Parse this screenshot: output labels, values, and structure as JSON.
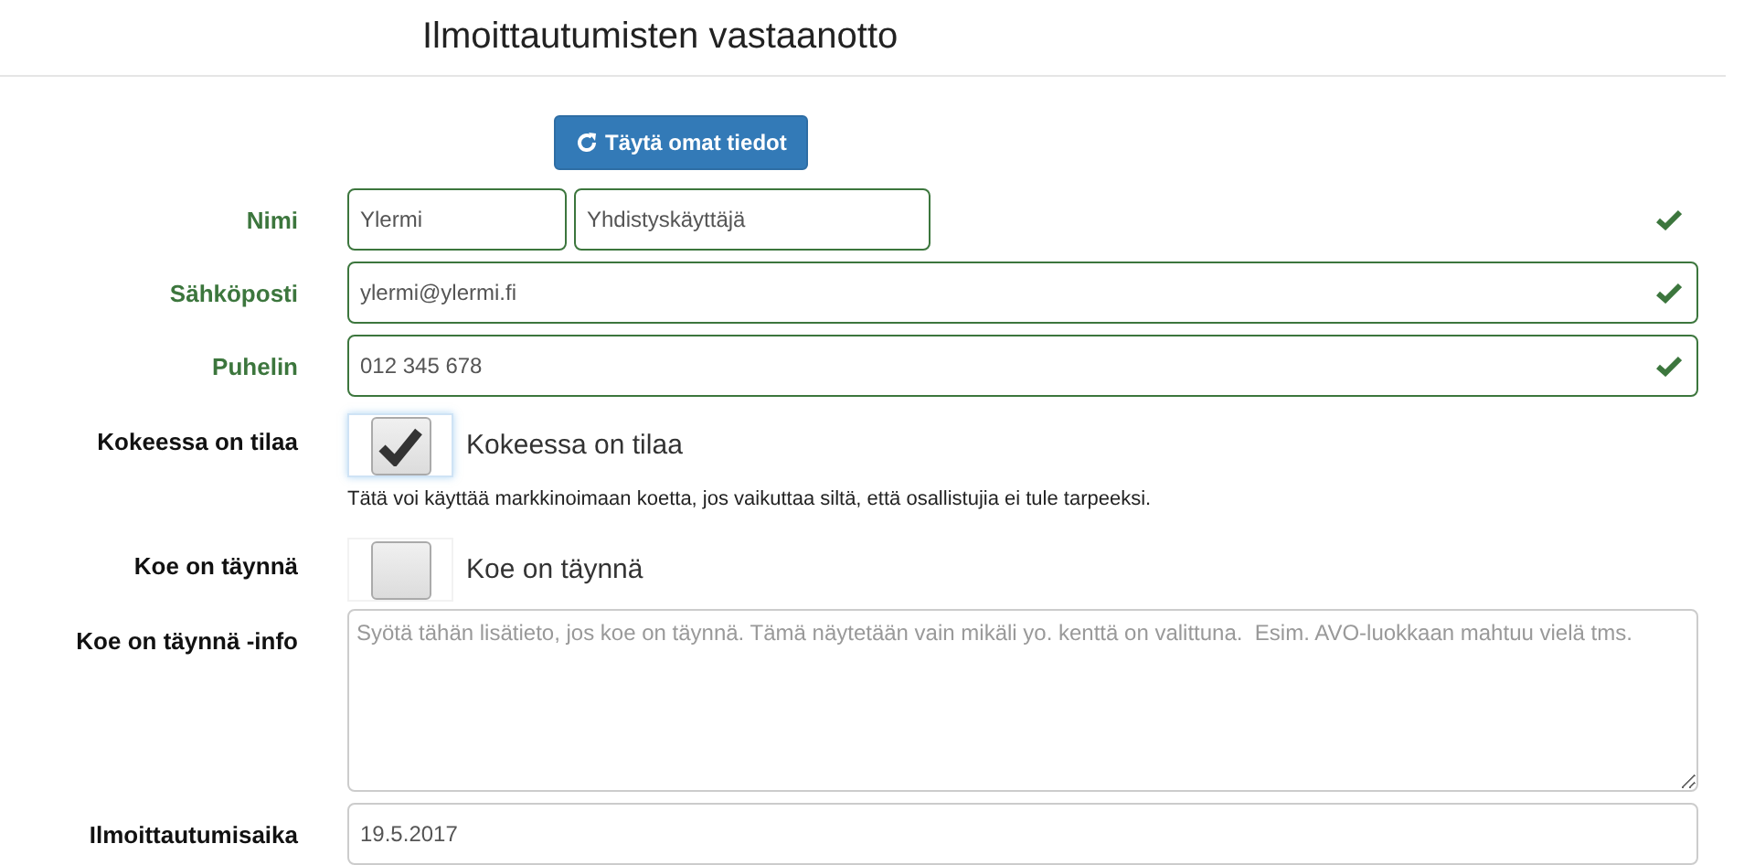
{
  "title": "Ilmoittautumisten vastaanotto",
  "fill_button": {
    "label": "Täytä omat tiedot"
  },
  "fields": [
    {
      "kind": "name",
      "label": "Nimi",
      "valid": true,
      "values": [
        "Ylermi",
        "Yhdistyskäyttäjä"
      ]
    },
    {
      "kind": "text",
      "label": "Sähköposti",
      "valid": true,
      "value": "ylermi@ylermi.fi"
    },
    {
      "kind": "text",
      "label": "Puhelin",
      "valid": true,
      "value": "012 345 678"
    },
    {
      "kind": "checkbox",
      "label": "Kokeessa on tilaa",
      "checked": true,
      "focused": true,
      "caption": "Kokeessa on tilaa",
      "help": "Tätä voi käyttää markkinoimaan koetta, jos vaikuttaa siltä, että osallistujia ei tule tarpeeksi."
    },
    {
      "kind": "checkbox",
      "label": "Koe on täynnä",
      "checked": false,
      "focused": false,
      "caption": "Koe on täynnä"
    },
    {
      "kind": "textarea",
      "label": "Koe on täynnä -info",
      "placeholder": "Syötä tähän lisätieto, jos koe on täynnä. Tämä näytetään vain mikäli yo. kenttä on valittuna.  Esim. AVO-luokkaan mahtuu vielä tms."
    },
    {
      "kind": "text",
      "label": "Ilmoittautumisaika",
      "valid": false,
      "value": "19.5.2017"
    }
  ]
}
